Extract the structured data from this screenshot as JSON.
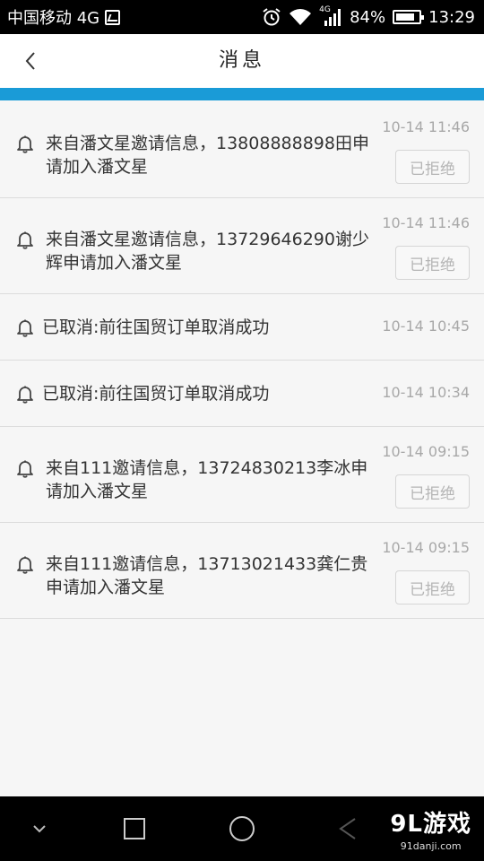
{
  "status_bar": {
    "carrier": "中国移动 4G",
    "network_badge": "4G",
    "battery_percent": "84%",
    "battery_level": 0.84,
    "time": "13:29"
  },
  "header": {
    "title": "消息"
  },
  "messages": [
    {
      "text": "来自潘文星邀请信息，13808888898田申请加入潘文星",
      "time": "10-14 11:46",
      "status": "已拒绝"
    },
    {
      "text": "来自潘文星邀请信息，13729646290谢少辉申请加入潘文星",
      "time": "10-14 11:46",
      "status": "已拒绝"
    },
    {
      "text": "已取消:前往国贸订单取消成功",
      "time": "10-14 10:45"
    },
    {
      "text": "已取消:前往国贸订单取消成功",
      "time": "10-14 10:34"
    },
    {
      "text": "来自111邀请信息，13724830213李冰申请加入潘文星",
      "time": "10-14 09:15",
      "status": "已拒绝"
    },
    {
      "text": "来自111邀请信息，13713021433龚仁贵申请加入潘文星",
      "time": "10-14 09:15",
      "status": "已拒绝"
    }
  ],
  "watermark": {
    "logo": "9L游戏",
    "url": "91danji.com"
  },
  "icons": {
    "back": "chevron-left-icon",
    "bell": "bell-icon",
    "alarm": "alarm-icon",
    "wifi": "wifi-icon",
    "signal": "signal-icon",
    "battery": "battery-icon"
  },
  "colors": {
    "accent": "#1a9bd7",
    "background": "#f6f6f6",
    "header": "#ffffff",
    "time_text": "#a8a8a8"
  }
}
